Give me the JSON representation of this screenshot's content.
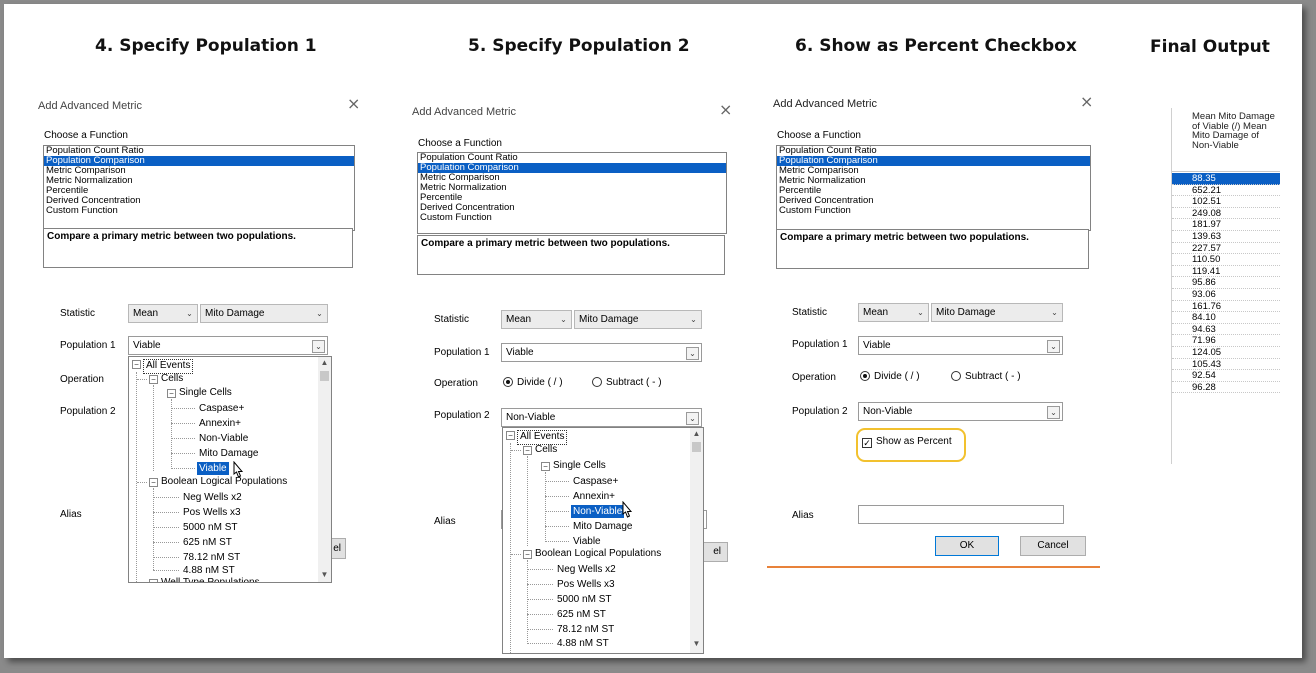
{
  "steps": [
    {
      "title": "4.  Specify Population 1"
    },
    {
      "title": "5. Specify Population 2"
    },
    {
      "title": "6. Show as Percent Checkbox"
    },
    {
      "title": "Final Output"
    }
  ],
  "dialog": {
    "title": "Add Advanced Metric",
    "close_glyph": "×",
    "choose_label": "Choose a Function",
    "functions": [
      "Population Count Ratio",
      "Population Comparison",
      "Metric Comparison",
      "Metric Normalization",
      "Percentile",
      "Derived Concentration",
      "Custom Function"
    ],
    "selected_function_index": 1,
    "description": "Compare a primary metric between two populations.",
    "statistic_label": "Statistic",
    "statistic_value": "Mean",
    "metric_value": "Mito Damage",
    "population1_label": "Population 1",
    "population1_value": "Viable",
    "operation_label": "Operation",
    "divide_label": "Divide ( / )",
    "subtract_label": "Subtract ( - )",
    "population2_label": "Population 2",
    "population2_value": "Non-Viable",
    "show_percent_label": "Show as Percent",
    "alias_label": "Alias",
    "ok_label": "OK",
    "cancel_label": "Cancel",
    "cancel_partial": "el"
  },
  "tree": {
    "all_events": "All Events",
    "cells": "Cells",
    "single_cells": "Single Cells",
    "caspase": "Caspase+",
    "annexin": "Annexin+",
    "non_viable": "Non-Viable",
    "mito_damage": "Mito Damage",
    "viable": "Viable",
    "boolean": "Boolean Logical Populations",
    "neg_wells": "Neg Wells x2",
    "pos_wells": "Pos Wells x3",
    "c5000": "5000 nM ST",
    "c625": "625 nM ST",
    "c78": "78.12 nM ST",
    "c488": "4.88 nM ST",
    "well_type": "Well Type Populations"
  },
  "output": {
    "header": "Mean Mito Damage of Viable (/) Mean Mito Damage of Non-Viable",
    "values": [
      "88.35",
      "652.21",
      "102.51",
      "249.08",
      "181.97",
      "139.63",
      "227.57",
      "110.50",
      "119.41",
      "95.86",
      "93.06",
      "161.76",
      "84.10",
      "94.63",
      "71.96",
      "124.05",
      "105.43",
      "92.54",
      "96.28"
    ]
  },
  "colors": {
    "selection": "#0a5fc4",
    "highlight": "#f2c12e"
  }
}
